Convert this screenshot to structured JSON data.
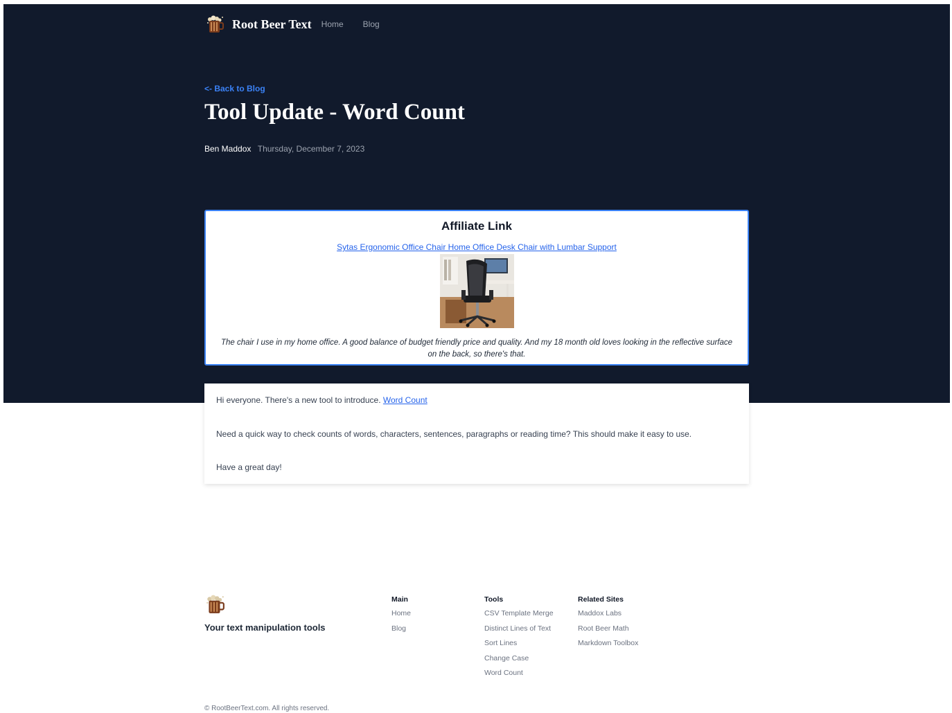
{
  "header": {
    "brand": "Root Beer Text",
    "nav": [
      "Home",
      "Blog"
    ]
  },
  "post": {
    "back_link": "<- Back to Blog",
    "title": "Tool Update - Word Count",
    "author": "Ben Maddox",
    "date": "Thursday, December 7, 2023"
  },
  "affiliate": {
    "heading": "Affiliate Link",
    "link_text": "Sytas Ergonomic Office Chair Home Office Desk Chair with Lumbar Support",
    "caption": "The chair I use in my home office. A good balance of budget friendly price and quality. And my 18 month old loves looking in the reflective surface on the back, so there's that."
  },
  "content": {
    "p1_text": "Hi everyone. There's a new tool to introduce.",
    "p1_link": "Word Count",
    "p2": "Need a quick way to check counts of words, characters, sentences, paragraphs or reading time? This should make it easy to use.",
    "p3": "Have a great day!"
  },
  "footer": {
    "tagline": "Your text manipulation tools",
    "main": {
      "heading": "Main",
      "links": [
        "Home",
        "Blog"
      ]
    },
    "tools": {
      "heading": "Tools",
      "links": [
        "CSV Template Merge",
        "Distinct Lines of Text",
        "Sort Lines",
        "Change Case",
        "Word Count"
      ]
    },
    "related": {
      "heading": "Related Sites",
      "links": [
        "Maddox Labs",
        "Root Beer Math",
        "Markdown Toolbox"
      ]
    },
    "copyright": "© RootBeerText.com. All rights reserved."
  },
  "colors": {
    "hero_bg": "#111a2c",
    "accent": "#3b82f6",
    "link": "#2563eb"
  },
  "icons": {
    "logo": "root-beer-mug-icon",
    "product": "office-chair-image"
  }
}
